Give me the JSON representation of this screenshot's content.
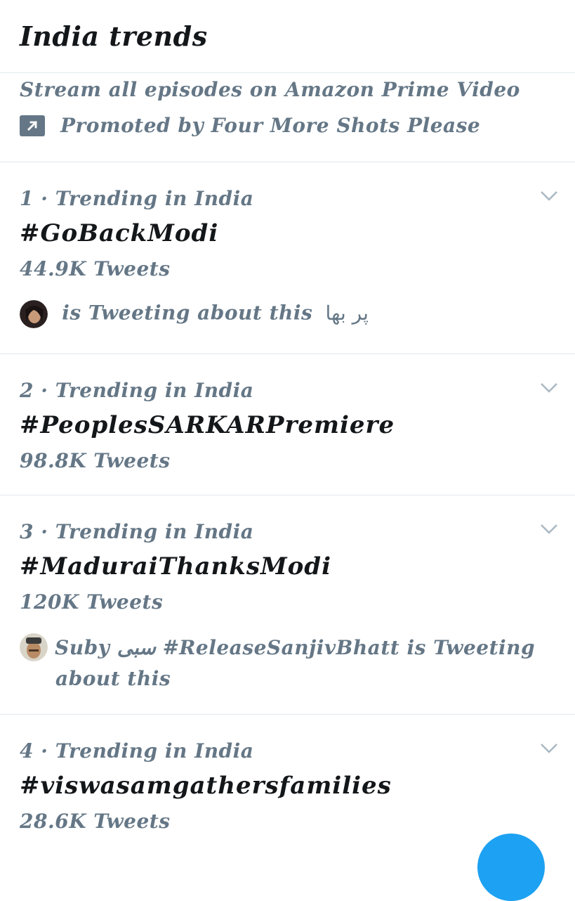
{
  "header": {
    "title": "India trends"
  },
  "promo": {
    "description": "Stream all episodes on Amazon Prime Video",
    "promoted_label": "Promoted by Four More Shots Please"
  },
  "trends": [
    {
      "meta": "1 · Trending in India",
      "tag": "#GoBackModi",
      "count": "44.9K Tweets",
      "context_text": "is Tweeting about this",
      "context_name": "پر بھا"
    },
    {
      "meta": "2 · Trending in India",
      "tag": "#PeoplesSARKARPremiere",
      "count": "98.8K Tweets"
    },
    {
      "meta": "3 · Trending in India",
      "tag": "#MaduraiThanksModi",
      "count": "120K Tweets",
      "context_line1": "Suby  سبی  #ReleaseSanjivBhatt  is Tweeting",
      "context_line2": "about this"
    },
    {
      "meta": "4 · Trending in India",
      "tag": "#viswasamgathersfamilies",
      "count": "28.6K Tweets"
    }
  ],
  "icons": {
    "promoted": "arrow-up-right-icon",
    "caret": "chevron-down-icon"
  },
  "colors": {
    "primary_text": "#14171a",
    "secondary_text": "#657786",
    "divider": "#e1e8ed",
    "accent": "#1da1f2"
  }
}
